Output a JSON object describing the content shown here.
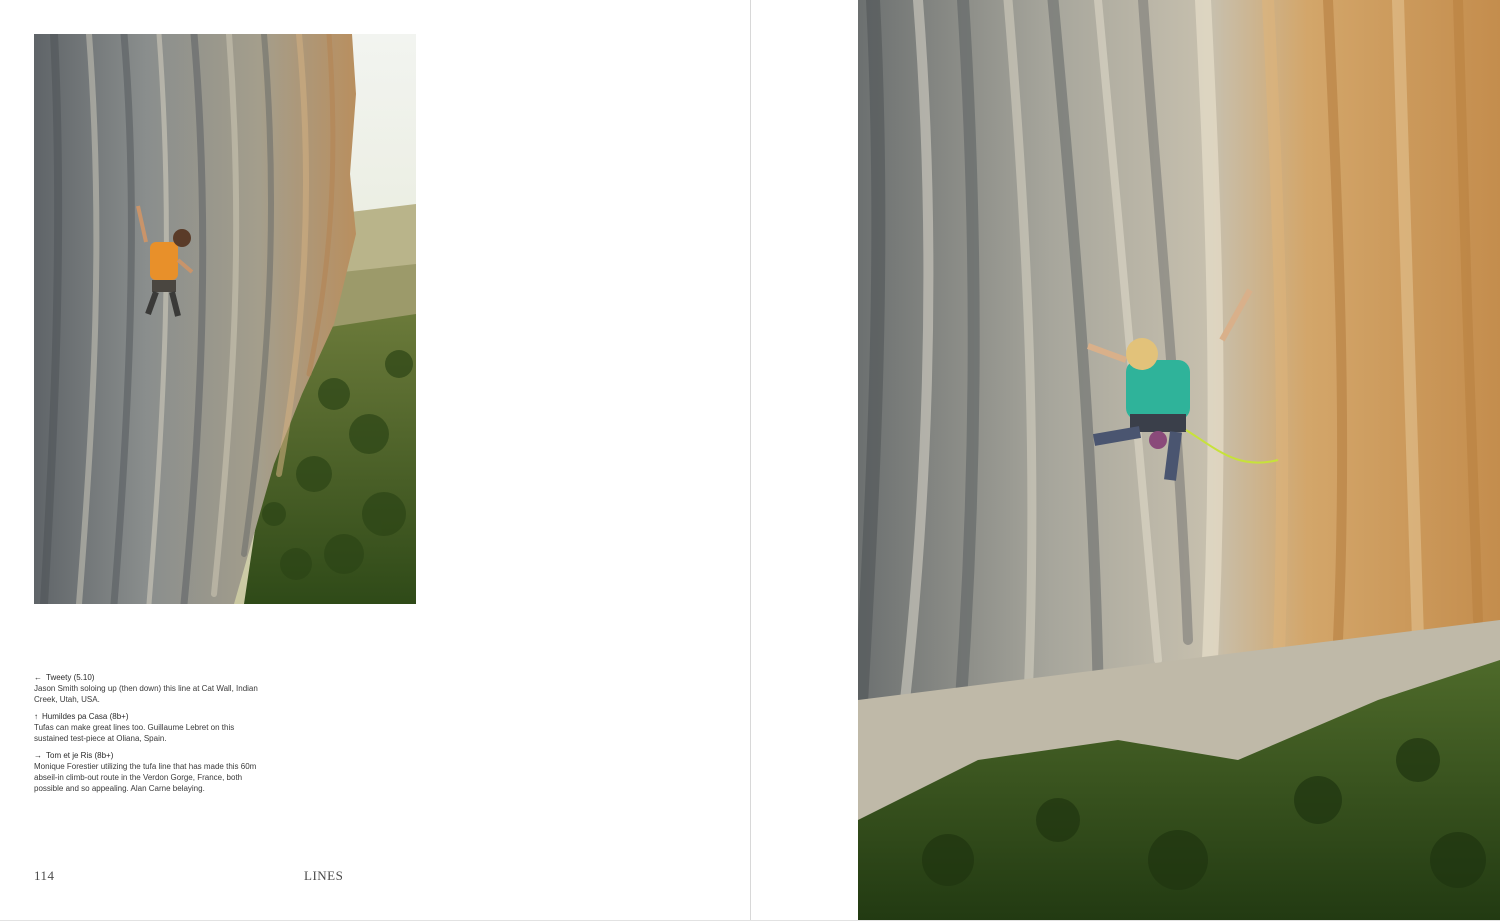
{
  "spread": {
    "left_page": {
      "folio": "114",
      "running_head": "LINES",
      "photo": {
        "alt": "Climber in orange shirt on a streaked limestone wall above a forested valley"
      },
      "captions": [
        {
          "arrow": "←",
          "title": "Tweety (5.10)",
          "body": "Jason Smith soloing up (then down) this line at Cat Wall, Indian Creek, Utah, USA."
        },
        {
          "arrow": "↑",
          "title": "Humildes pa Casa (8b+)",
          "body": "Tufas can make great lines too. Guillaume Lebret on this sustained test-piece at Oliana, Spain."
        },
        {
          "arrow": "→",
          "title": "Tom et je Ris (8b+)",
          "body": "Monique Forestier utilizing the tufa line that has made this 60m abseil-in climb-out route in the Verdon Gorge, France, both possible and so appealing. Alan Carne belaying."
        }
      ]
    },
    "right_page": {
      "photo": {
        "alt": "Climber in teal top on a tufa line of a massive grey-and-orange limestone wall, forest far below"
      }
    }
  },
  "colors": {
    "page_bg": "#ffffff",
    "rule": "#d8d8d8",
    "text": "#3a3a3a",
    "rock_grey": "#8c8e8c",
    "rock_orange": "#c99a5e",
    "forest": "#3f5a22",
    "shirt_orange": "#e8902a",
    "top_teal": "#2fb39a"
  }
}
